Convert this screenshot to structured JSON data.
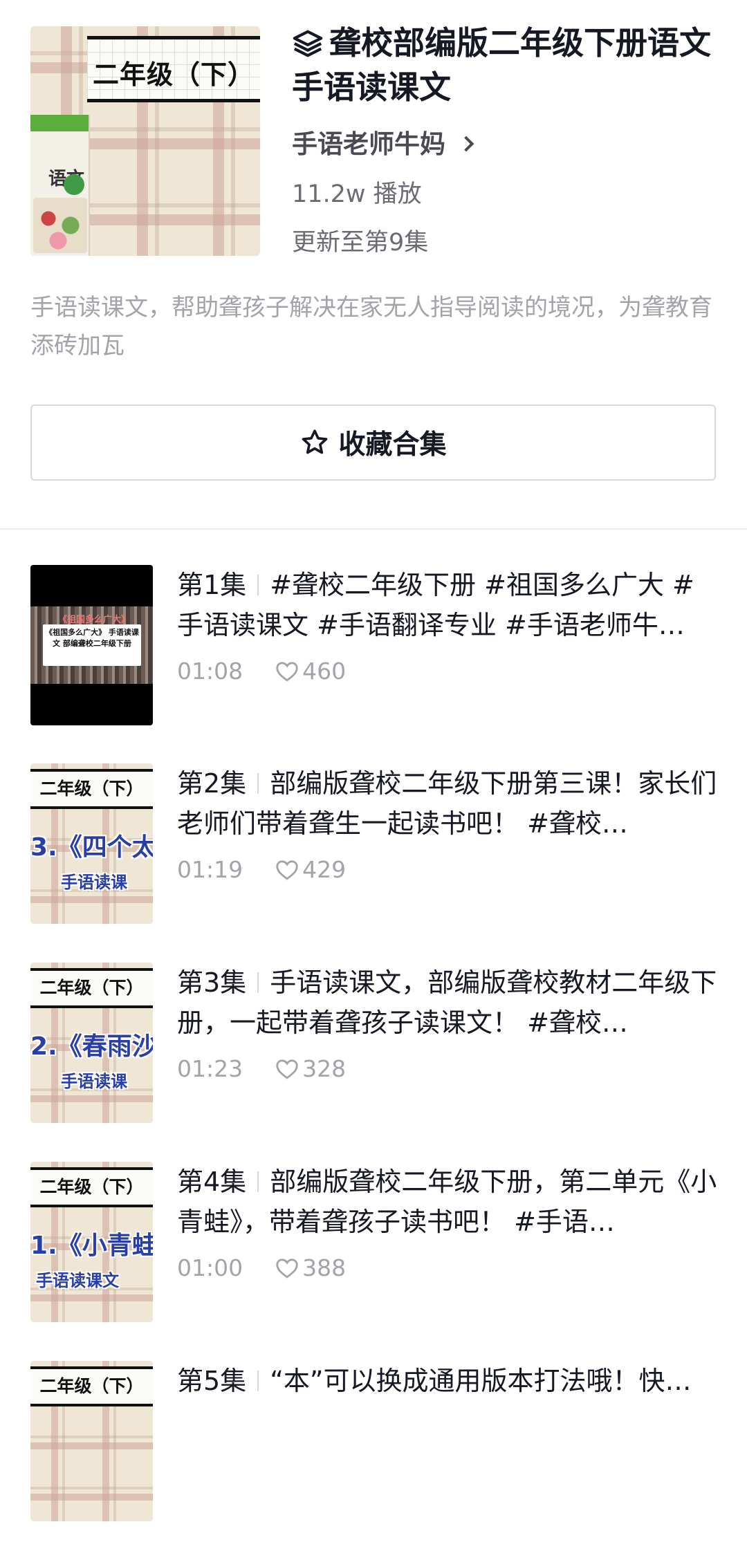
{
  "collection": {
    "cover_banner": "二年级（下）",
    "cover_book_title": "语文",
    "title": "聋校部编版二年级下册语文 手语读课文",
    "author": "手语老师牛妈",
    "plays": "11.2w 播放",
    "update_status": "更新至第9集",
    "description": "手语读课文，帮助聋孩子解决在家无人指导阅读的境况，为聋教育添砖加瓦",
    "favorite_label": "收藏合集"
  },
  "episodes": [
    {
      "number": "第1集",
      "title": "#聋校二年级下册 #祖国多么广大 #手语读课文 #手语翻译专业 #手语老师牛…",
      "duration": "01:08",
      "likes": "460",
      "thumb_top": "《祖国多么广大》",
      "thumb_caption": "《祖国多么广大》 手语读课文 部编聋校二年级下册"
    },
    {
      "number": "第2集",
      "title": "部编版聋校二年级下册第三课！家长们老师们带着聋生一起读书吧！ #聋校…",
      "duration": "01:19",
      "likes": "429",
      "thumb_band": "二年级（下）",
      "thumb_lesson": "3.《四个太",
      "thumb_sub": "手语读课"
    },
    {
      "number": "第3集",
      "title": "手语读课文，部编版聋校教材二年级下册，一起带着聋孩子读课文！ #聋校…",
      "duration": "01:23",
      "likes": "328",
      "thumb_band": "二年级（下）",
      "thumb_lesson": "2.《春雨沙",
      "thumb_sub": "手语读课"
    },
    {
      "number": "第4集",
      "title": "部编版聋校二年级下册，第二单元《小青蛙》，带着聋孩子读书吧！ #手语…",
      "duration": "01:00",
      "likes": "388",
      "thumb_band": "二年级（下）",
      "thumb_lesson": "1.《小青蛙",
      "thumb_sub": "手语读课文"
    },
    {
      "number": "第5集",
      "title": "“本”可以换成通用版本打法哦！快…",
      "duration": "",
      "likes": "",
      "thumb_band": "二年级（下）",
      "thumb_lesson": "",
      "thumb_sub": ""
    }
  ]
}
